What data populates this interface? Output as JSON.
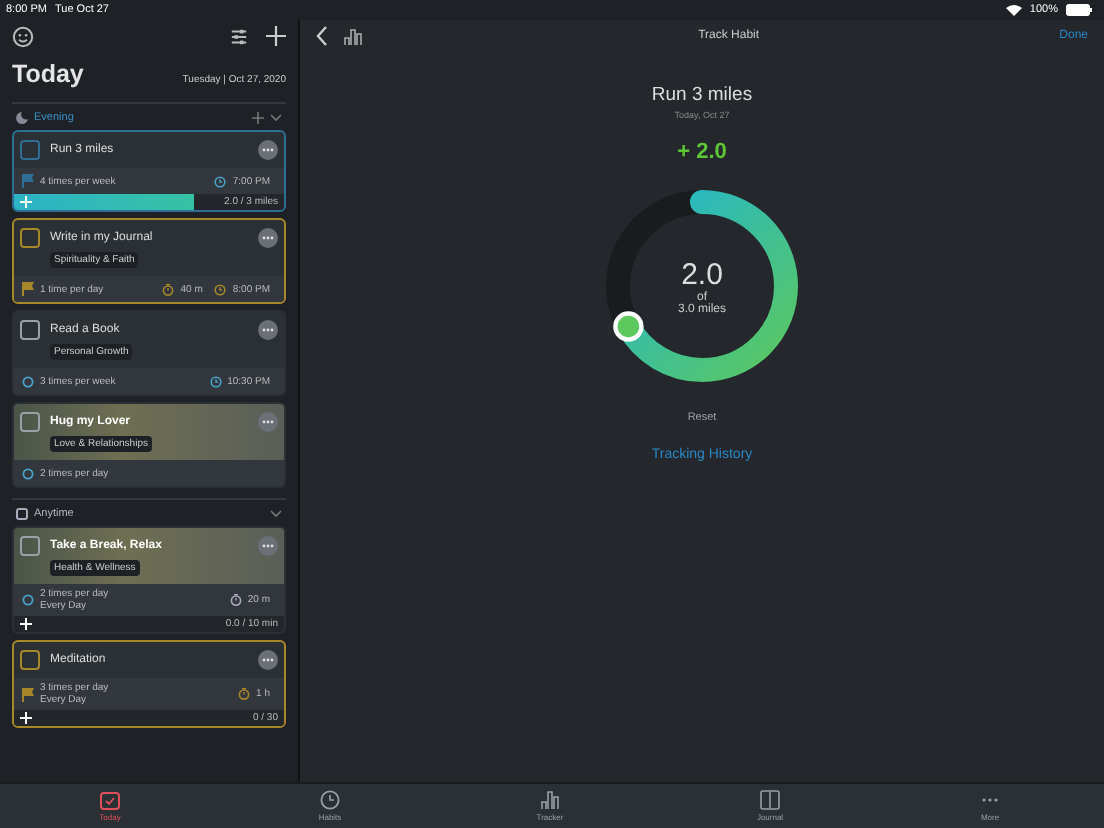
{
  "status_bar": {
    "time": "8:00 PM",
    "date": "Tue Oct 27",
    "battery": "100%"
  },
  "sidebar": {
    "title": "Today",
    "date": "Tuesday | Oct 27, 2020",
    "sections": [
      {
        "name": "Evening",
        "kind": "evening",
        "habits": [
          {
            "title": "Run 3 miles",
            "color": "#2e6e96",
            "checked": false,
            "photo": false,
            "frequency": {
              "kind": "goal",
              "lines": [
                "4 times per week"
              ]
            },
            "time": "7:00 PM",
            "progress": {
              "text": "2.0 / 3 miles",
              "level": 0.67
            }
          },
          {
            "title": "Write in my Journal",
            "color": "#a8862a",
            "checked": false,
            "photo": false,
            "tag": "Spirituality & Faith",
            "frequency": {
              "kind": "goal",
              "lines": [
                "1 time per day"
              ]
            },
            "duration": "40 m",
            "time": "8:00 PM"
          },
          {
            "title": "Read a Book",
            "checked": false,
            "photo": false,
            "tag": "Personal Growth",
            "frequency": {
              "kind": "repeat",
              "lines": [
                "3 times per week"
              ]
            },
            "time": "10:30 PM"
          },
          {
            "title": "Hug my Lover",
            "checked": false,
            "photo": true,
            "tag": "Love & Relationships",
            "frequency": {
              "kind": "repeat",
              "lines": [
                "2 times per day"
              ]
            }
          }
        ]
      },
      {
        "name": "Anytime",
        "kind": "anytime",
        "habits": [
          {
            "title": "Take a Break, Relax",
            "checked": false,
            "photo": true,
            "tag": "Health & Wellness",
            "frequency": {
              "kind": "repeat",
              "lines": [
                "2 times per day",
                "Every Day"
              ]
            },
            "duration": "20 m",
            "progress": {
              "text": "0.0 / 10 min",
              "level": 0
            }
          },
          {
            "title": "Meditation",
            "color": "#a8862a",
            "checked": false,
            "photo": false,
            "frequency": {
              "kind": "goal",
              "lines": [
                "3 times per day",
                "Every Day"
              ]
            },
            "duration": "1 h",
            "progress": {
              "text": "0 / 30",
              "level": 0
            }
          }
        ]
      }
    ]
  },
  "nav": {
    "title": "Track Habit",
    "done": "Done"
  },
  "tracker": {
    "title": "Run 3 miles",
    "date": "Today, Oct 27",
    "increment": "+ 2.0",
    "value": "2.0",
    "of": "of",
    "target": "3.0 miles",
    "level": 0.67,
    "reset": "Reset",
    "history": "Tracking History"
  },
  "tab_bar": [
    {
      "label": "Today",
      "kind": "today",
      "selected": true
    },
    {
      "label": "Habits",
      "kind": "habits",
      "selected": false
    },
    {
      "label": "Tracker",
      "kind": "tracker",
      "selected": false
    },
    {
      "label": "Journal",
      "kind": "journal",
      "selected": false
    },
    {
      "label": "More",
      "kind": "more",
      "selected": false
    }
  ]
}
